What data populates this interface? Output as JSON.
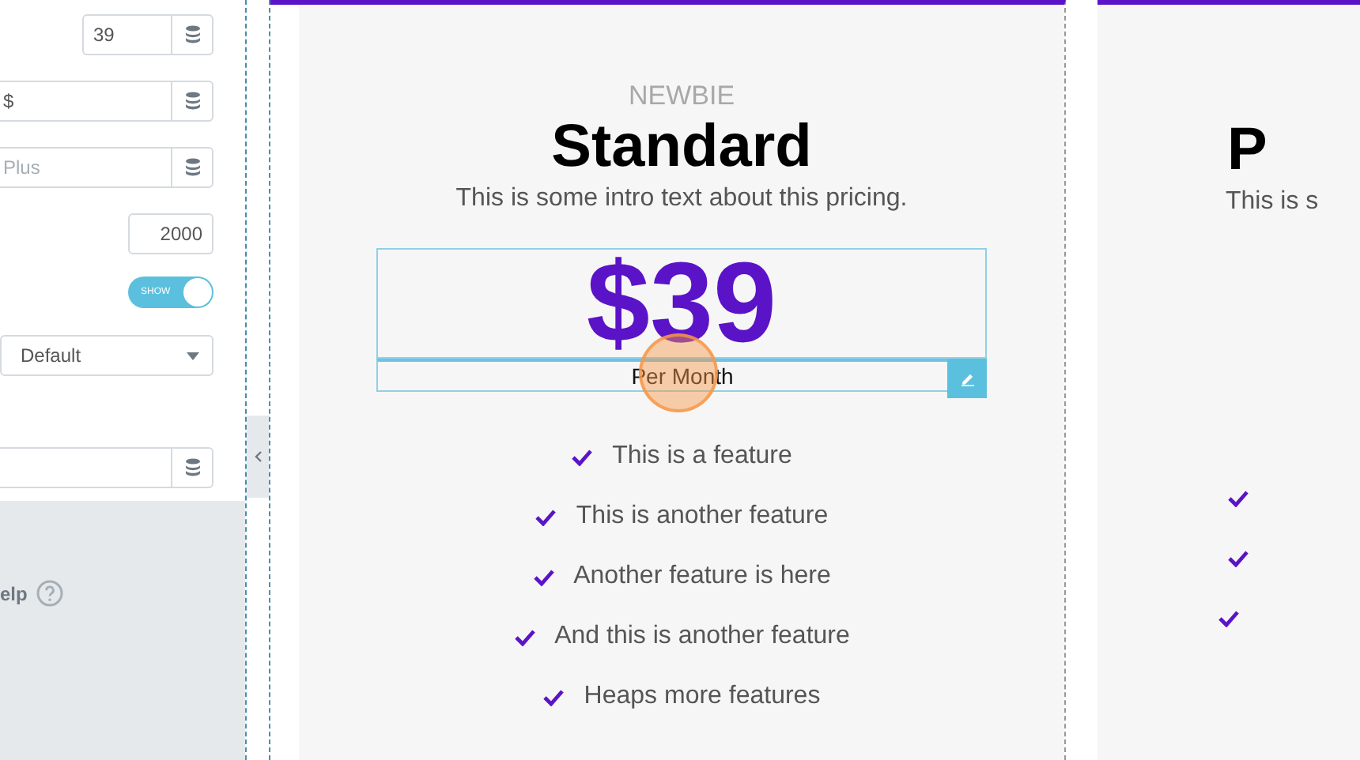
{
  "panel": {
    "fields": [
      {
        "kind": "short",
        "value": "39"
      },
      {
        "kind": "dynamic",
        "value": "$"
      },
      {
        "kind": "dynamic",
        "placeholder": "Plus"
      },
      {
        "kind": "number",
        "value": "2000"
      },
      {
        "kind": "toggle",
        "label": "SHOW",
        "on": true
      },
      {
        "kind": "select",
        "value": "Default"
      },
      {
        "kind": "dynamic"
      }
    ],
    "help": "elp"
  },
  "cards": [
    {
      "tag": "NEWBIE",
      "title": "Standard",
      "intro": "This is some intro text about this pricing.",
      "price": "$39",
      "period": "Per Month",
      "features": [
        {
          "kind": "check",
          "text": "This is a feature"
        },
        {
          "kind": "check",
          "text": "This is another feature"
        },
        {
          "kind": "check",
          "text": "Another feature is here"
        },
        {
          "kind": "check",
          "text": "And this is another feature"
        },
        {
          "kind": "check",
          "text": "Heaps more features"
        }
      ]
    },
    {
      "title": "P",
      "intro": "This is s",
      "features": [
        {
          "kind": "check"
        },
        {
          "kind": "check"
        },
        {
          "kind": "check"
        }
      ]
    }
  ]
}
